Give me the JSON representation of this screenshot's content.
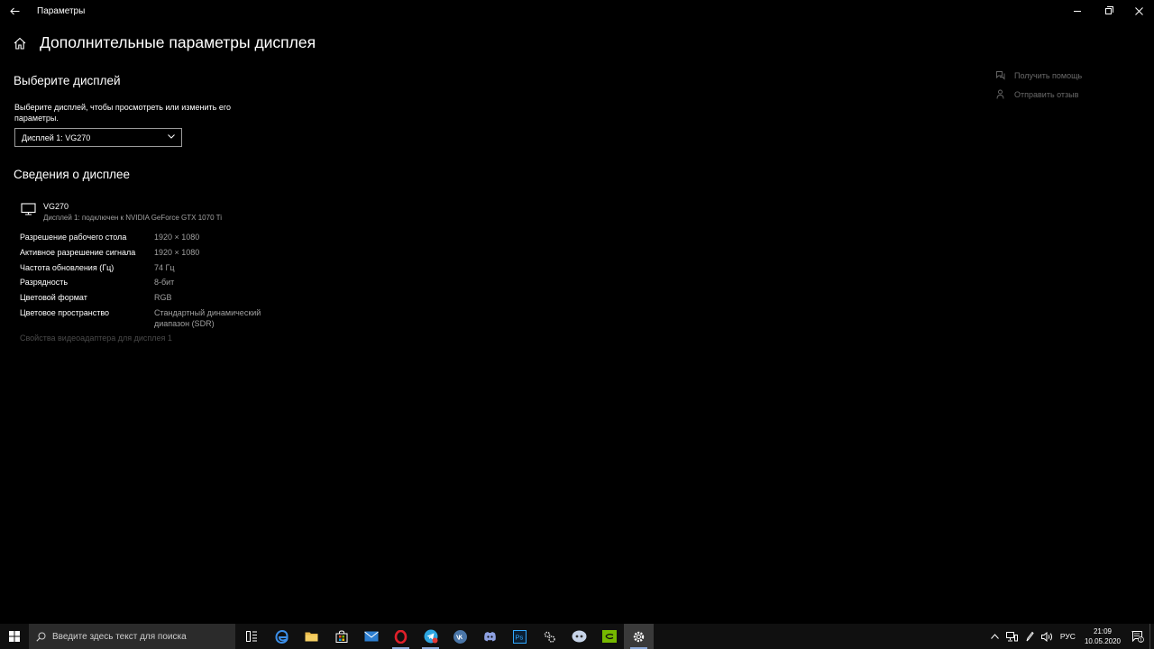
{
  "window": {
    "app_title": "Параметры",
    "back_icon": "back-arrow-icon"
  },
  "page": {
    "title": "Дополнительные параметры дисплея"
  },
  "select_display": {
    "heading": "Выберите дисплей",
    "description": "Выберите дисплей, чтобы просмотреть или изменить его параметры.",
    "selected": "Дисплей 1: VG270"
  },
  "display_info": {
    "heading": "Сведения о дисплее",
    "monitor_name": "VG270",
    "monitor_subtitle": "Дисплей 1: подключен к NVIDIA GeForce GTX 1070 Ti",
    "rows": [
      {
        "label": "Разрешение рабочего стола",
        "value": "1920 × 1080"
      },
      {
        "label": "Активное разрешение сигнала",
        "value": "1920 × 1080"
      },
      {
        "label": "Частота обновления (Гц)",
        "value": "74 Гц"
      },
      {
        "label": "Разрядность",
        "value": "8-бит"
      },
      {
        "label": "Цветовой формат",
        "value": "RGB"
      },
      {
        "label": "Цветовое пространство",
        "value": "Стандартный динамический диапазон (SDR)"
      }
    ],
    "adapter_link": "Свойства видеоадаптера для дисплея 1"
  },
  "help": {
    "get_help": "Получить помощь",
    "feedback": "Отправить отзыв"
  },
  "taskbar": {
    "search_placeholder": "Введите здесь текст для поиска",
    "tray": {
      "language": "РУС",
      "time": "21:09",
      "date": "10.05.2020",
      "notification_count": "1"
    }
  },
  "colors": {
    "background": "#000000",
    "taskbar": "#101010",
    "secondary_text": "#a0a0a0",
    "disabled_text": "#4a4a4a"
  }
}
